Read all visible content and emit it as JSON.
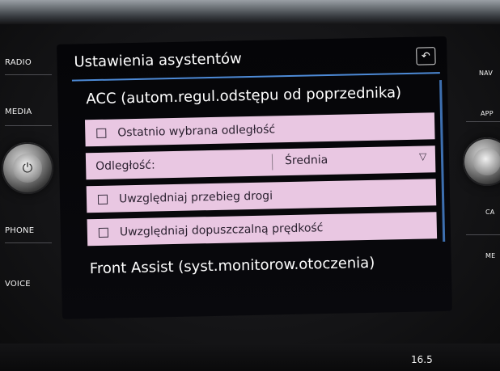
{
  "side_buttons": {
    "left": [
      "RADIO",
      "MEDIA",
      "PHONE",
      "VOICE"
    ],
    "right": [
      "NAV",
      "APP",
      "CA",
      "ME"
    ]
  },
  "screen": {
    "title": "Ustawienia asystentów",
    "back_icon": "back-arrow-icon",
    "sections": {
      "acc_heading": "ACC (autom.regul.odstępu od poprzednika)",
      "front_heading": "Front Assist (syst.monitorow.otoczenia)"
    },
    "rows": {
      "last_distance": "Ostatnio wybrana odległość",
      "distance_label": "Odległość:",
      "distance_value": "Średnia",
      "road_course": "Uwzględniaj przebieg drogi",
      "speed_limit": "Uwzględniaj dopuszczalną prędkość"
    },
    "accent_color": "#4d8ad6",
    "row_color": "#e9c7e2"
  },
  "bottom_readout": "16.5"
}
